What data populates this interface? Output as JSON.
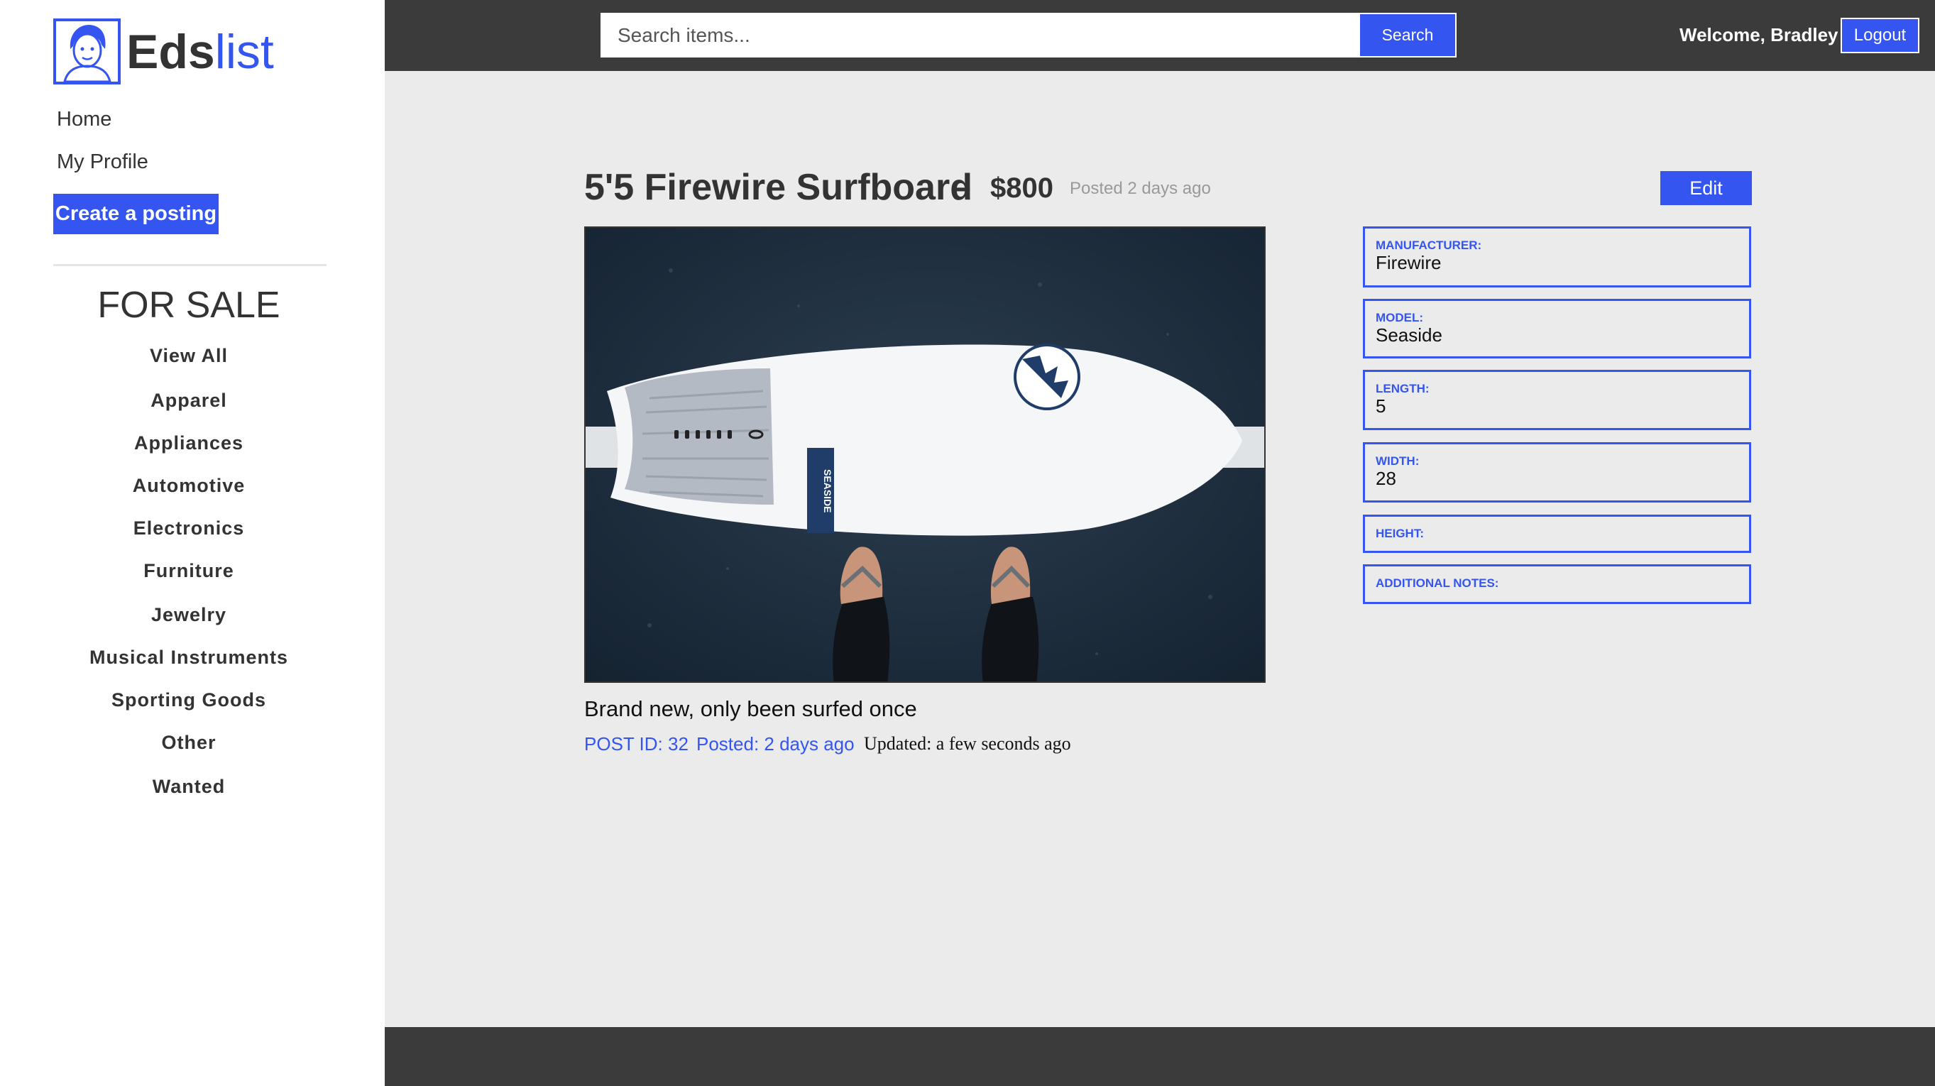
{
  "brand": {
    "bold": "Eds",
    "light": "list"
  },
  "nav": {
    "home": "Home",
    "profile": "My Profile",
    "create": "Create a posting"
  },
  "sidebar": {
    "heading": "FOR SALE",
    "categories": [
      "View All",
      "Apparel",
      "Appliances",
      "Automotive",
      "Electronics",
      "Furniture",
      "Jewelry",
      "Musical Instruments",
      "Sporting Goods",
      "Other",
      "Wanted"
    ]
  },
  "header": {
    "search_placeholder": "Search items...",
    "search_label": "Search",
    "welcome": "Welcome, Bradley",
    "logout_label": "Logout"
  },
  "post": {
    "title": "5'5 Firewire Surfboard",
    "dash": "–",
    "price": "$800",
    "posted": "Posted 2 days ago",
    "edit_label": "Edit",
    "description": "Brand new, only been surfed once",
    "post_id": "POST ID: 32",
    "posted_meta": "Posted: 2 days ago",
    "updated": "Updated: a few seconds ago",
    "board_model_text": "SEASIDE"
  },
  "specs": [
    {
      "label": "MANUFACTURER:",
      "value": "Firewire"
    },
    {
      "label": "MODEL:",
      "value": "Seaside"
    },
    {
      "label": "LENGTH:",
      "value": "5"
    },
    {
      "label": "WIDTH:",
      "value": "28"
    },
    {
      "label": "HEIGHT:",
      "value": ""
    },
    {
      "label": "ADDITIONAL NOTES:",
      "value": ""
    }
  ],
  "colors": {
    "accent": "#3455f0",
    "topbar": "#3b3b3b",
    "background": "#ebebeb"
  }
}
